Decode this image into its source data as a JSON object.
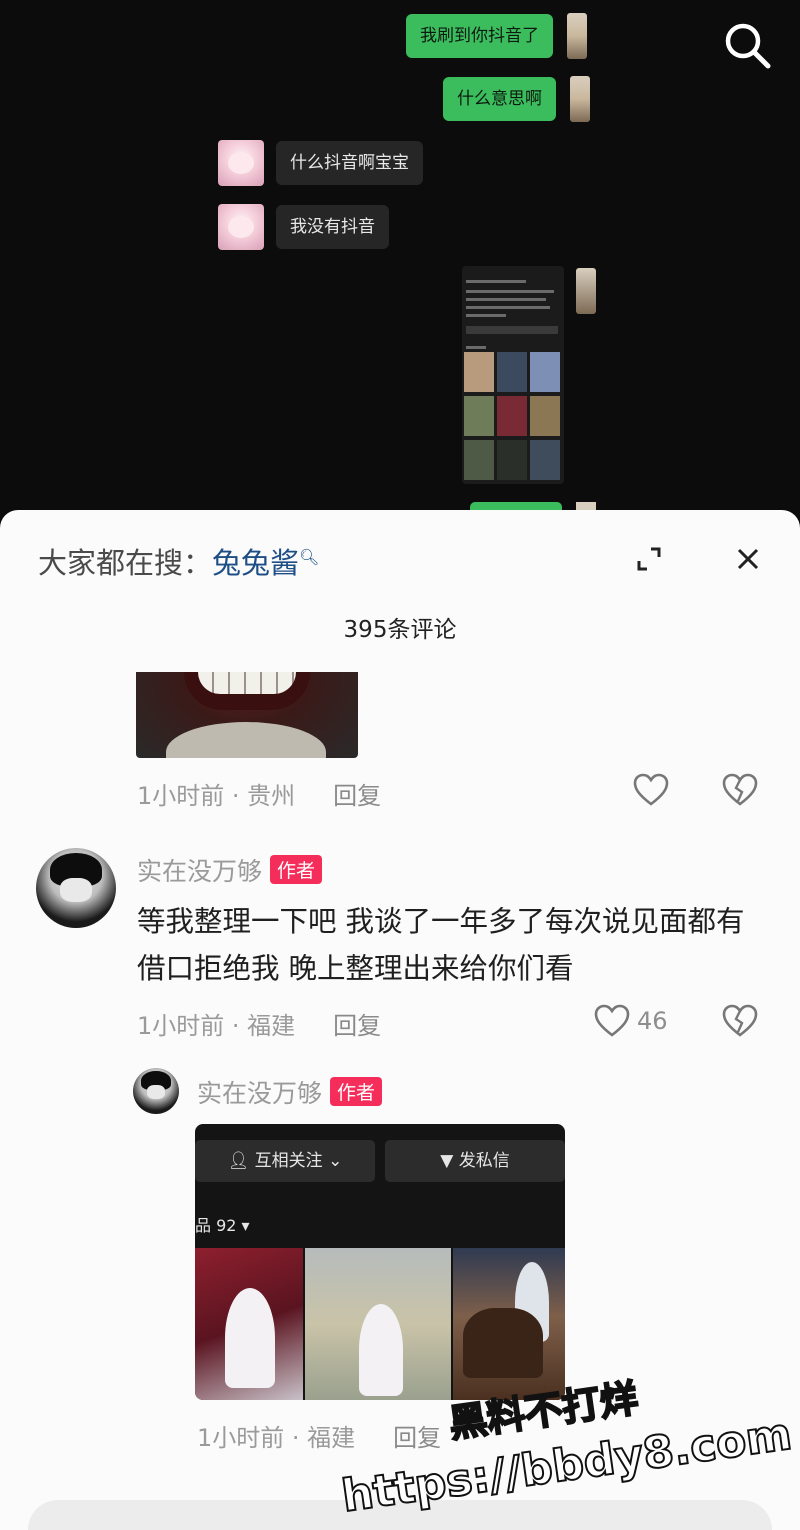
{
  "chat": {
    "messages": [
      {
        "side": "right",
        "text": "我刷到你抖音了"
      },
      {
        "side": "right",
        "text": "什么意思啊"
      },
      {
        "side": "left",
        "text": "什么抖音啊宝宝"
      },
      {
        "side": "left",
        "text": "我没有抖音"
      }
    ]
  },
  "sheet": {
    "hot_search_label": "大家都在搜：",
    "hot_search_term": "兔兔酱",
    "comment_count": "395条评论"
  },
  "comments": [
    {
      "time_location": "1小时前 · 贵州",
      "reply_label": "回复"
    },
    {
      "username": "实在没万够",
      "badge": "作者",
      "text": "等我整理一下吧 我谈了一年多了每次说见面都有借口拒绝我 晚上整理出来给你们看",
      "time_location": "1小时前 · 福建",
      "reply_label": "回复",
      "likes": "46"
    },
    {
      "username": "实在没万够",
      "badge": "作者",
      "time_location": "1小时前 · 福建",
      "reply_label": "回复"
    }
  ],
  "profile_image": {
    "follow_label": "互相关注",
    "message_label": "发私信",
    "works_label": "品 92"
  },
  "watermark": {
    "line1": "黑料不打烊",
    "line2": "https://bbdy8.com"
  },
  "colors": {
    "accent_green": "#3bbd5d",
    "author_badge": "#f52d5b",
    "hot_term": "#1e4e86"
  }
}
